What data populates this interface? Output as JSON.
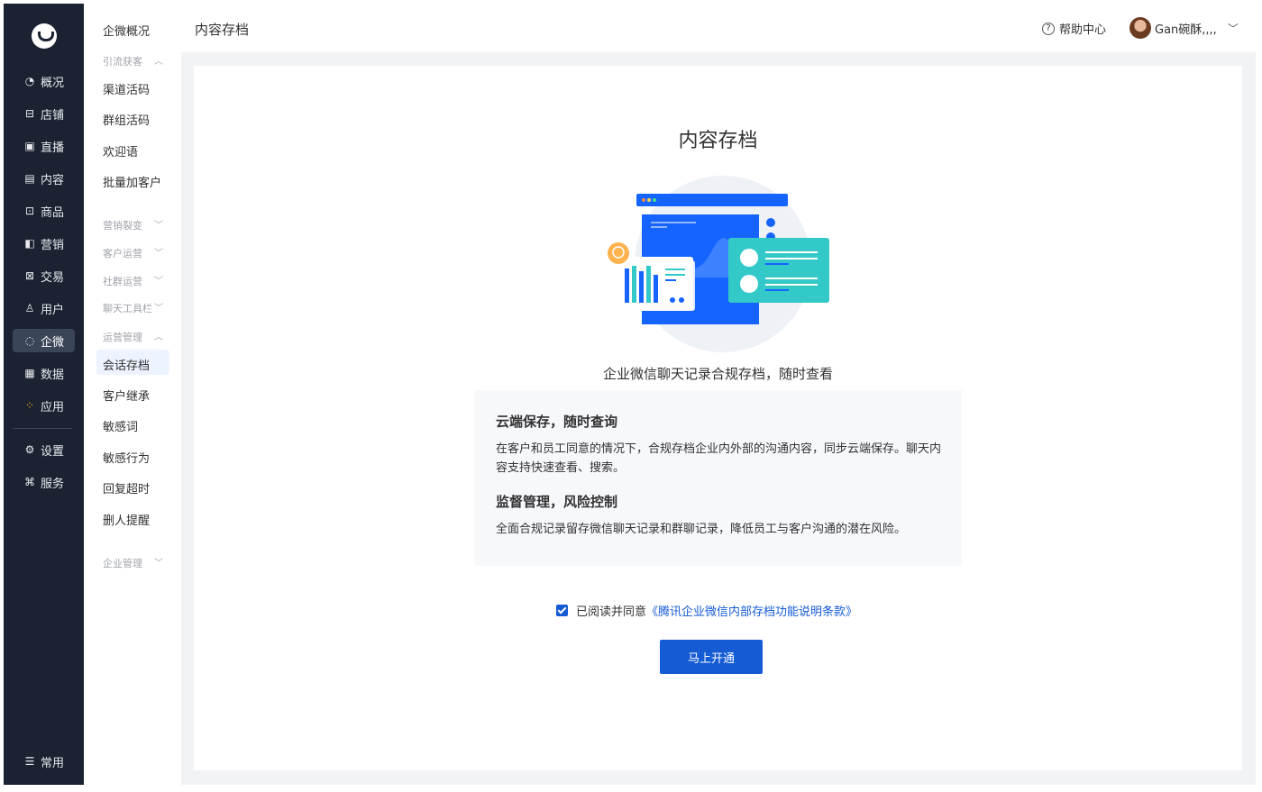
{
  "primary_nav": {
    "items": [
      {
        "label": "概况",
        "icon": "pie-chart-icon"
      },
      {
        "label": "店铺",
        "icon": "store-icon"
      },
      {
        "label": "直播",
        "icon": "live-icon"
      },
      {
        "label": "内容",
        "icon": "content-icon"
      },
      {
        "label": "商品",
        "icon": "goods-icon"
      },
      {
        "label": "营销",
        "icon": "megaphone-icon"
      },
      {
        "label": "交易",
        "icon": "trade-icon"
      },
      {
        "label": "用户",
        "icon": "user-icon"
      },
      {
        "label": "企微",
        "icon": "wecom-icon"
      },
      {
        "label": "数据",
        "icon": "data-icon"
      },
      {
        "label": "应用",
        "icon": "apps-icon"
      },
      {
        "label": "设置",
        "icon": "gear-icon"
      },
      {
        "label": "服务",
        "icon": "service-icon"
      },
      {
        "label": "常用",
        "icon": "list-icon"
      }
    ],
    "active": "企微"
  },
  "secondary_nav": {
    "overview": "企微概况",
    "groups": {
      "lead_gen": "引流获客",
      "marketing_split": "营销裂变",
      "customer_ops": "客户运营",
      "community_ops": "社群运营",
      "chat_toolbar": "聊天工具栏",
      "ops_mgmt": "运营管理",
      "enterprise_mgmt": "企业管理"
    },
    "links": {
      "channel_code": "渠道活码",
      "group_code": "群组活码",
      "welcome": "欢迎语",
      "batch_add": "批量加客户",
      "session_archive": "会话存档",
      "customer_inherit": "客户继承",
      "sensitive_words": "敏感词",
      "sensitive_actions": "敏感行为",
      "reply_timeout": "回复超时",
      "delete_remind": "删人提醒"
    }
  },
  "header": {
    "title": "内容存档",
    "help": "帮助中心",
    "user_name": "Gan碗酥,,,,"
  },
  "main": {
    "title": "内容存档",
    "subtitle": "企业微信聊天记录合规存档，随时查看",
    "features": [
      {
        "title": "云端保存，随时查询",
        "desc": "在客户和员工同意的情况下，合规存档企业内外部的沟通内容，同步云端保存。聊天内容支持快速查看、搜索。"
      },
      {
        "title": "监督管理，风险控制",
        "desc": "全面合规记录留存微信聊天记录和群聊记录，降低员工与客户沟通的潜在风险。"
      }
    ],
    "agree_text": "已阅读并同意",
    "agree_link": "《腾讯企业微信内部存档功能说明条款》",
    "agree_checked": true,
    "cta": "马上开通"
  },
  "colors": {
    "primary": "#155bd4",
    "sidebar": "#1b2333",
    "accent_teal": "#33c9c9"
  }
}
